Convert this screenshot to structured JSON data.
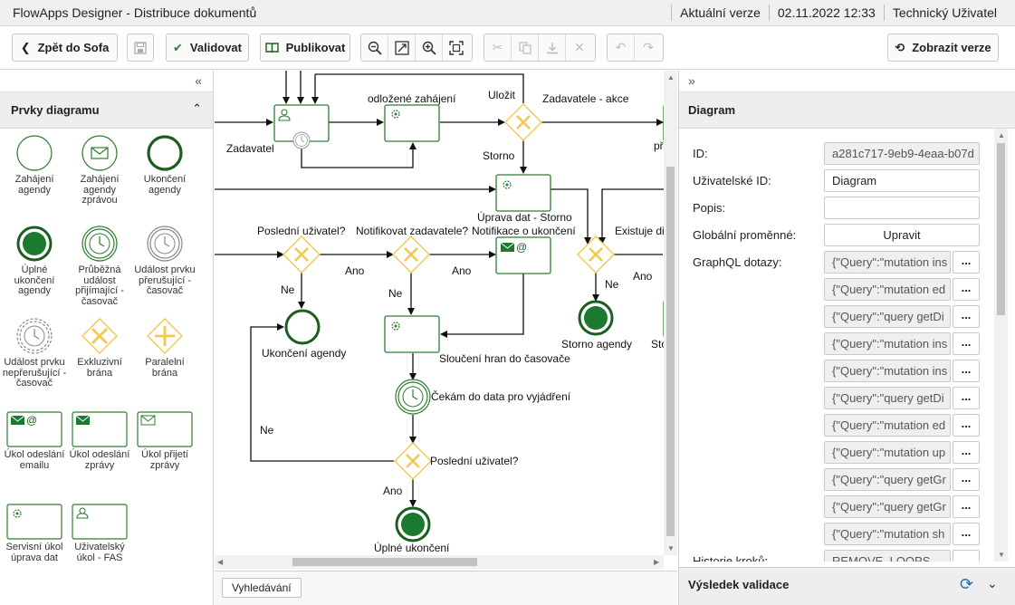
{
  "window": {
    "title": "FlowApps Designer - Distribuce dokumentů",
    "version": "Aktuální verze",
    "datetime": "02.11.2022 12:33",
    "user": "Technický Uživatel"
  },
  "toolbar": {
    "back_label": "Zpět do Sofa",
    "validate_label": "Validovat",
    "publish_label": "Publikovat",
    "show_versions_label": "Zobrazit verze"
  },
  "left_panel": {
    "title": "Prvky diagramu",
    "items": [
      {
        "label": "Zahájení agendy"
      },
      {
        "label": "Zahájení agendy zprávou"
      },
      {
        "label": "Ukončení agendy"
      },
      {
        "label": "Úplné ukončení agendy"
      },
      {
        "label": "Průběžná událost přijímající - časovač"
      },
      {
        "label": "Událost prvku přerušující - časovač"
      },
      {
        "label": "Událost prvku nepřerušující - časovač"
      },
      {
        "label": "Exkluzivní brána"
      },
      {
        "label": "Paralelní brána"
      },
      {
        "label": "Úkol odeslání emailu"
      },
      {
        "label": "Úkol odeslání zprávy"
      },
      {
        "label": "Úkol přijetí zprávy"
      },
      {
        "label": "Servisní úkol úprava dat"
      },
      {
        "label": "Uživatelský úkol - FAS"
      }
    ]
  },
  "diagram": {
    "labels": {
      "zadavatel": "Zadavatel",
      "odlozene": "odložené zahájení",
      "ulozit": "Uložit",
      "zadavatel_akce": "Zadavatele - akce",
      "pr": "př",
      "storno": "Storno",
      "uprava_dat": "Úprava dat - Storno",
      "posledni1": "Poslední uživatel?",
      "notifikovat": "Notifikovat zadavatele?",
      "notifikace": "Notifikace o ukončení",
      "existuje": "Existuje di",
      "ano1": "Ano",
      "ano2": "Ano",
      "ano3": "Ano",
      "ne1": "Ne",
      "ne2": "Ne",
      "ne3": "Ne",
      "ukonceni": "Ukončení agendy",
      "slouceni": "Sloučení hran do časovače",
      "storno_agendy": "Storno agendy",
      "sto": "Sto",
      "cekam": "Čekám do data pro vyjádření",
      "ne4": "Ne",
      "posledni2": "Poslední uživatel?",
      "ano4": "Ano",
      "uplne": "Úplné ukončení"
    }
  },
  "search_label": "Vyhledávání",
  "right_panel": {
    "title": "Diagram",
    "props": [
      {
        "label": "ID:",
        "value": "a281c717-9eb9-4eaa-b07d"
      },
      {
        "label": "Uživatelské ID:",
        "value": "Diagram"
      },
      {
        "label": "Popis:",
        "value": ""
      },
      {
        "label": "Globální proměnné:",
        "value": "Upravit"
      },
      {
        "label": "GraphQL dotazy:",
        "value": "{\"Query\":\"mutation ins"
      },
      {
        "label": "",
        "value": "{\"Query\":\"mutation ed"
      },
      {
        "label": "",
        "value": "{\"Query\":\"query getDi"
      },
      {
        "label": "",
        "value": "{\"Query\":\"mutation ins"
      },
      {
        "label": "",
        "value": "{\"Query\":\"mutation ins"
      },
      {
        "label": "",
        "value": "{\"Query\":\"query getDi"
      },
      {
        "label": "",
        "value": "{\"Query\":\"mutation ed"
      },
      {
        "label": "",
        "value": "{\"Query\":\"mutation up"
      },
      {
        "label": "",
        "value": "{\"Query\":\"query getGr"
      },
      {
        "label": "",
        "value": "{\"Query\":\"query getGr"
      },
      {
        "label": "",
        "value": "{\"Query\":\"mutation sh"
      },
      {
        "label": "Historie kroků:",
        "value": "REMOVE_LOOPS"
      }
    ],
    "dots_label": "...",
    "validation_title": "Výsledek validace"
  },
  "colors": {
    "bpmn_green": "#2e7d32",
    "gateway_yellow": "#f2c94c"
  }
}
